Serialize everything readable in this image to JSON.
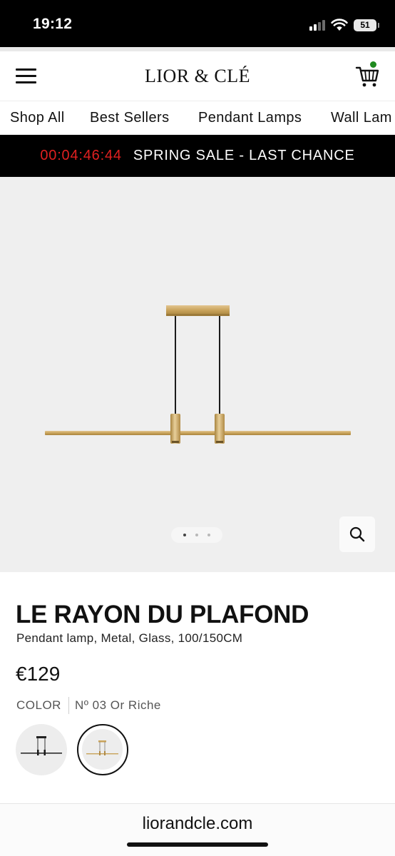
{
  "status_bar": {
    "time": "19:12",
    "battery": "51",
    "icons": [
      "cellular-signal-icon",
      "wifi-icon",
      "battery-icon"
    ]
  },
  "header": {
    "logo": "LIOR & CLÉ",
    "icons": [
      "hamburger-menu-icon",
      "shopping-cart-icon"
    ],
    "cart_indicator_color": "#1f8a1f"
  },
  "nav": {
    "items": [
      {
        "label": "Shop All"
      },
      {
        "label": "Best Sellers"
      },
      {
        "label": "Pendant Lamps"
      },
      {
        "label": "Wall Lam"
      }
    ]
  },
  "sale_banner": {
    "countdown": "00:04:46:44",
    "text": "SPRING SALE - LAST CHANCE",
    "countdown_color": "#e02020"
  },
  "gallery": {
    "slide_count": 3,
    "active_slide": 1,
    "zoom_icon": "search-icon"
  },
  "product": {
    "title": "LE RAYON DU PLAFOND",
    "subtitle": "Pendant lamp, Metal, Glass, 100/150CM",
    "price": "€129",
    "color_label": "COLOR",
    "color_value": "Nº 03 Or Riche",
    "swatches": [
      {
        "variant": "black",
        "selected": false
      },
      {
        "variant": "gold",
        "selected": true
      }
    ]
  },
  "browser": {
    "url": "liorandcle.com"
  },
  "colors": {
    "brass": "#c9a35a",
    "banner_bg": "#000000",
    "image_bg": "#efefef"
  }
}
